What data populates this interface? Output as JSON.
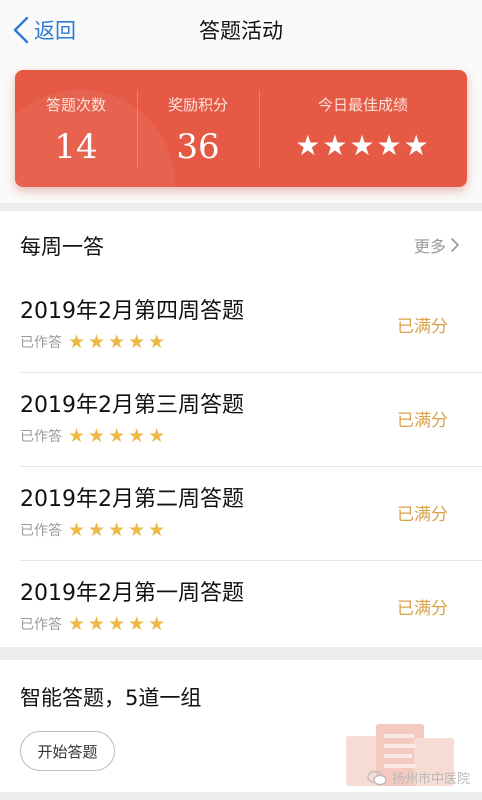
{
  "nav": {
    "back_label": "返回",
    "title": "答题活动"
  },
  "stats": {
    "answers_label": "答题次数",
    "answers_value": "14",
    "points_label": "奖励积分",
    "points_value": "36",
    "best_label": "今日最佳成绩",
    "best_stars": "★★★★★",
    "best_rating": 5
  },
  "weekly": {
    "title": "每周一答",
    "more_label": "更多",
    "items": [
      {
        "title": "2019年2月第四周答题",
        "status": "已作答",
        "stars": "★★★★★",
        "rating": 5,
        "badge": "已满分"
      },
      {
        "title": "2019年2月第三周答题",
        "status": "已作答",
        "stars": "★★★★★",
        "rating": 5,
        "badge": "已满分"
      },
      {
        "title": "2019年2月第二周答题",
        "status": "已作答",
        "stars": "★★★★★",
        "rating": 5,
        "badge": "已满分"
      },
      {
        "title": "2019年2月第一周答题",
        "status": "已作答",
        "stars": "★★★★★",
        "rating": 5,
        "badge": "已满分"
      }
    ]
  },
  "smart": {
    "title": "智能答题，5道一组",
    "start_label": "开始答题"
  },
  "watermark": {
    "text": "扬州市中医院",
    "icon": "wechat-icon"
  },
  "colors": {
    "accent_red": "#e65a45",
    "star_gold": "#eeb844",
    "badge_gold": "#d9a24a",
    "link_blue": "#2e7bd6"
  }
}
